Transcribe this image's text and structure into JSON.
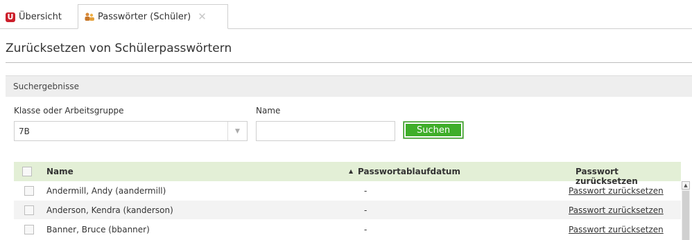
{
  "tabs": [
    {
      "label": "Übersicht",
      "icon": "u-logo-icon"
    },
    {
      "label": "Passwörter (Schüler)",
      "icon": "users-key-icon",
      "active": true
    }
  ],
  "page": {
    "title": "Zurücksetzen von Schülerpasswörtern"
  },
  "section": {
    "title": "Suchergebnisse"
  },
  "form": {
    "class_label": "Klasse oder Arbeitsgruppe",
    "class_value": "7B",
    "name_label": "Name",
    "name_value": "",
    "search_label": "Suchen"
  },
  "table": {
    "headers": {
      "name": "Name",
      "expiry": "Passwortablaufdatum",
      "reset": "Passwort zurücksetzen"
    },
    "sort": "ascending",
    "rows": [
      {
        "name": "Andermill, Andy (aandermill)",
        "expiry": "-",
        "action": "Passwort zurücksetzen"
      },
      {
        "name": "Anderson, Kendra (kanderson)",
        "expiry": "-",
        "action": "Passwort zurücksetzen"
      },
      {
        "name": "Banner, Bruce (bbanner)",
        "expiry": "-",
        "action": "Passwort zurücksetzen"
      }
    ]
  },
  "colors": {
    "accent_green": "#3fae2a",
    "header_green": "#e3efd6",
    "brand_red": "#cc1f2b"
  }
}
